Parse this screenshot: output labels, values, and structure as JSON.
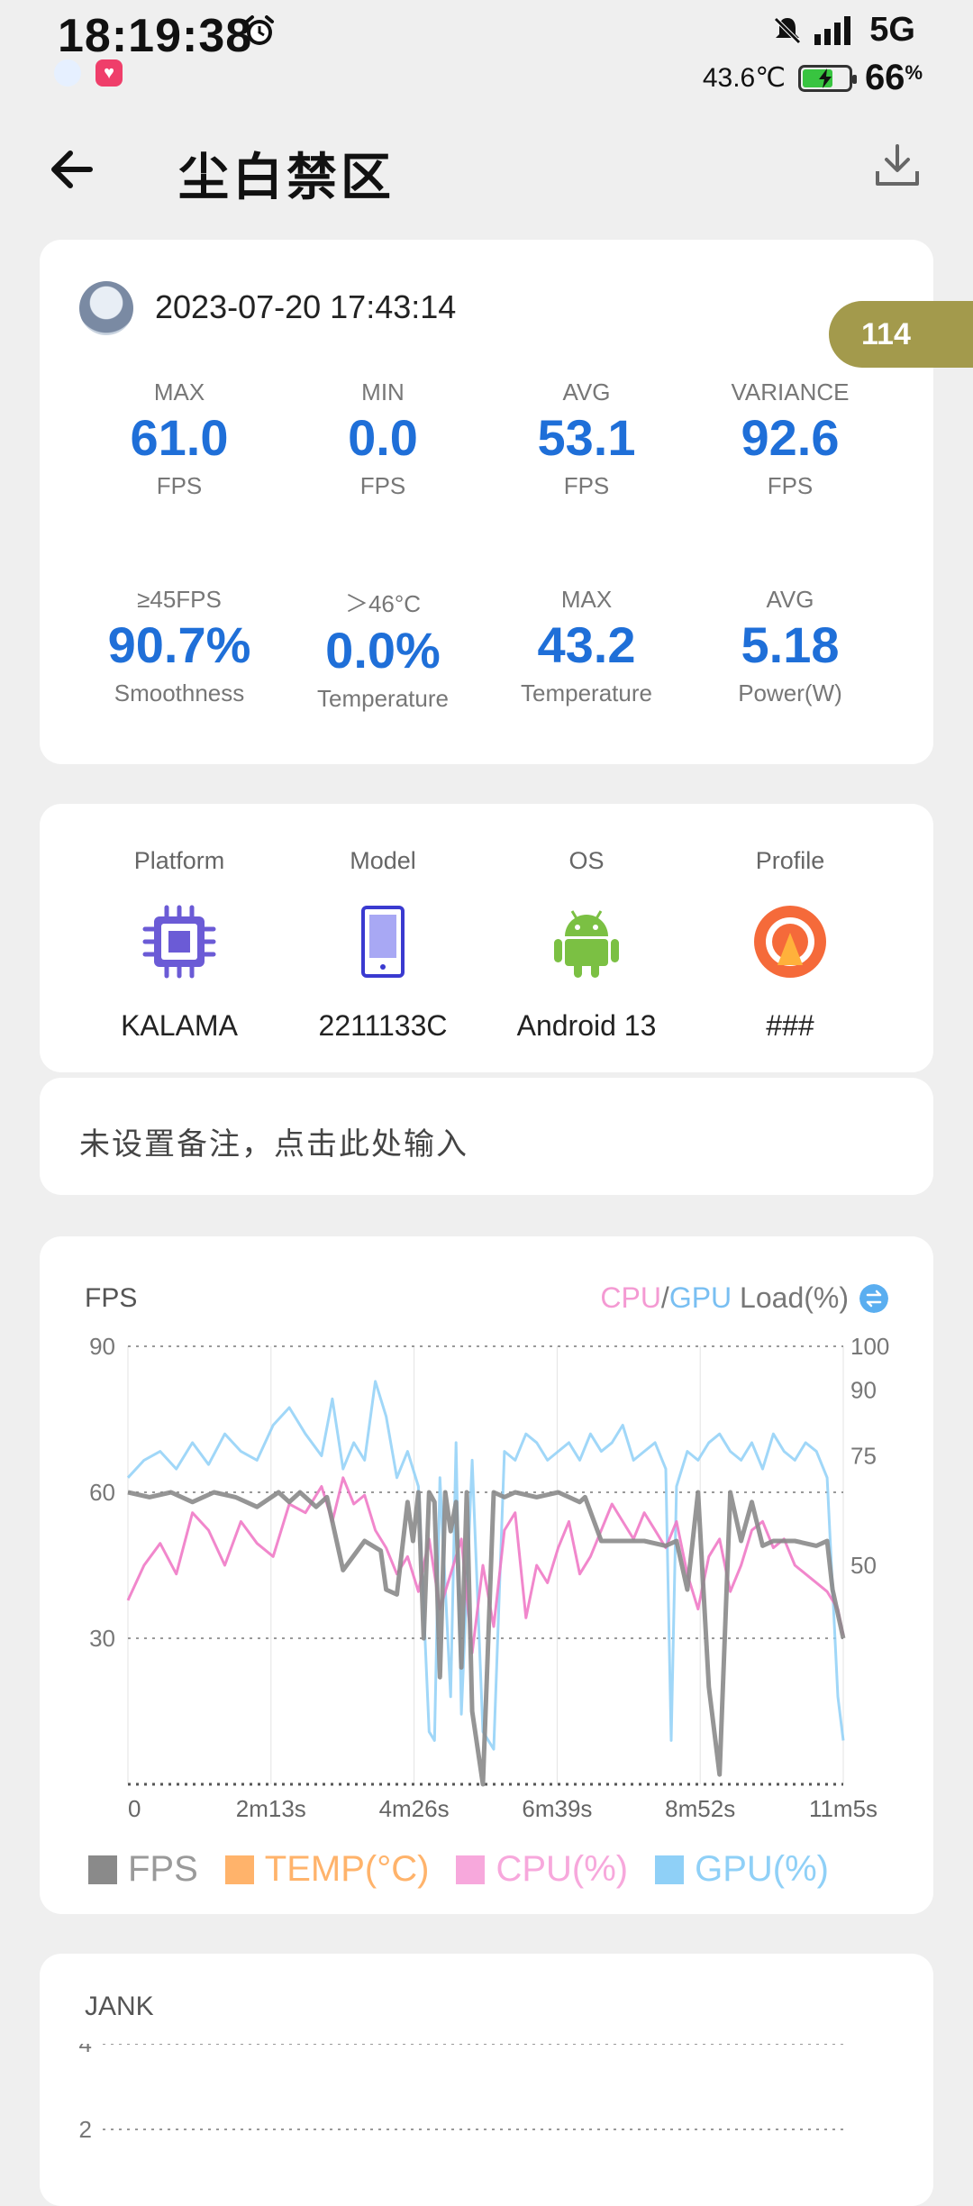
{
  "status_bar": {
    "time": "18:19:38",
    "network": "5G",
    "temperature": "43.6℃",
    "battery": "66",
    "battery_pct_sign": "%",
    "battery_level": 0.66,
    "icons": [
      "alarm-icon",
      "mute-icon",
      "signal-icon",
      "battery-charging-icon",
      "app-notification-icon",
      "heart-notification-icon"
    ]
  },
  "header": {
    "title": "尘白禁区",
    "back_icon": "back-arrow-icon",
    "download_icon": "download-icon"
  },
  "summary": {
    "datetime": "2023-07-20 17:43:14",
    "badge": "114",
    "stats_row1": [
      {
        "label": "MAX",
        "value": "61.0",
        "unit": "FPS"
      },
      {
        "label": "MIN",
        "value": "0.0",
        "unit": "FPS"
      },
      {
        "label": "AVG",
        "value": "53.1",
        "unit": "FPS"
      },
      {
        "label": "VARIANCE",
        "value": "92.6",
        "unit": "FPS"
      }
    ],
    "stats_row2": [
      {
        "label": "≥45FPS",
        "value": "90.7%",
        "unit": "Smoothness"
      },
      {
        "label": "＞46°C",
        "value": "0.0%",
        "unit": "Temperature"
      },
      {
        "label": "MAX",
        "value": "43.2",
        "unit": "Temperature"
      },
      {
        "label": "AVG",
        "value": "5.18",
        "unit": "Power(W)"
      }
    ]
  },
  "device": {
    "items": [
      {
        "label": "Platform",
        "value": "KALAMA",
        "icon": "chip-icon"
      },
      {
        "label": "Model",
        "value": "2211133C",
        "icon": "phone-icon"
      },
      {
        "label": "OS",
        "value": "Android 13",
        "icon": "android-icon"
      },
      {
        "label": "Profile",
        "value": "###",
        "icon": "profile-icon"
      }
    ]
  },
  "note": {
    "text": "未设置备注，点击此处输入"
  },
  "fps_chart": {
    "title": "FPS",
    "toggle_cpu": "CPU",
    "toggle_sep": "/",
    "toggle_gpu": "GPU",
    "toggle_suffix": " Load(%)",
    "colors": {
      "fps": "#8a8a8a",
      "temp": "#ffb36b",
      "cpu": "#f07ac6",
      "gpu": "#8fd0f7"
    },
    "legend": [
      "FPS",
      "TEMP(°C)",
      "CPU(%)",
      "GPU(%)"
    ]
  },
  "jank_chart": {
    "title": "JANK"
  },
  "chart_data": [
    {
      "type": "line",
      "title": "FPS",
      "xlabel": "",
      "ylabel": "",
      "x_ticks": [
        "0",
        "2m13s",
        "4m26s",
        "6m39s",
        "8m52s",
        "11m5s"
      ],
      "x_tick_seconds": [
        0,
        133,
        266,
        399,
        532,
        665
      ],
      "xlim": [
        0,
        665
      ],
      "ylim": [
        0,
        90
      ],
      "y_ticks": [
        "90",
        "60",
        "30"
      ],
      "y2lim": [
        0,
        100
      ],
      "y2_ticks": [
        "100",
        "90",
        "75",
        "50"
      ],
      "grid": true,
      "legend_position": "bottom",
      "series": [
        {
          "name": "FPS",
          "axis": "left",
          "x": [
            0,
            20,
            40,
            60,
            80,
            100,
            120,
            140,
            150,
            160,
            175,
            185,
            200,
            220,
            235,
            240,
            250,
            260,
            265,
            270,
            275,
            280,
            285,
            290,
            295,
            300,
            305,
            310,
            315,
            320,
            330,
            340,
            350,
            360,
            380,
            400,
            420,
            425,
            440,
            460,
            480,
            500,
            510,
            512,
            520,
            530,
            540,
            550,
            560,
            570,
            580,
            590,
            600,
            620,
            640,
            650,
            655,
            665
          ],
          "values": [
            60,
            59,
            60,
            58,
            60,
            59,
            57,
            60,
            58,
            60,
            57,
            59,
            44,
            50,
            48,
            40,
            39,
            58,
            50,
            60,
            30,
            60,
            58,
            22,
            60,
            52,
            58,
            24,
            60,
            15,
            0,
            60,
            59,
            60,
            59,
            60,
            58,
            59,
            50,
            50,
            50,
            49,
            50,
            48,
            40,
            60,
            20,
            2,
            60,
            50,
            58,
            49,
            50,
            50,
            49,
            50,
            40,
            30
          ]
        },
        {
          "name": "CPU(%)",
          "axis": "right",
          "x": [
            0,
            15,
            30,
            45,
            60,
            75,
            90,
            105,
            120,
            135,
            150,
            165,
            180,
            190,
            200,
            210,
            220,
            230,
            240,
            250,
            260,
            270,
            280,
            290,
            300,
            310,
            320,
            330,
            340,
            350,
            360,
            370,
            380,
            390,
            400,
            410,
            420,
            430,
            440,
            450,
            460,
            470,
            480,
            490,
            500,
            510,
            520,
            530,
            540,
            550,
            560,
            570,
            580,
            590,
            600,
            610,
            620,
            630,
            640,
            650,
            660,
            665
          ],
          "values": [
            42,
            50,
            55,
            48,
            62,
            58,
            50,
            60,
            55,
            52,
            64,
            62,
            68,
            60,
            70,
            64,
            66,
            58,
            54,
            48,
            52,
            44,
            56,
            40,
            48,
            56,
            30,
            50,
            36,
            58,
            62,
            38,
            50,
            46,
            54,
            60,
            48,
            52,
            58,
            64,
            60,
            56,
            62,
            58,
            54,
            60,
            48,
            40,
            52,
            56,
            44,
            50,
            58,
            60,
            54,
            56,
            50,
            48,
            46,
            44,
            40,
            34
          ]
        },
        {
          "name": "GPU(%)",
          "axis": "right",
          "x": [
            0,
            15,
            30,
            45,
            60,
            75,
            90,
            105,
            120,
            135,
            150,
            165,
            180,
            190,
            200,
            210,
            220,
            230,
            240,
            250,
            260,
            270,
            280,
            285,
            290,
            300,
            305,
            310,
            320,
            330,
            340,
            350,
            360,
            370,
            380,
            390,
            400,
            410,
            420,
            430,
            440,
            450,
            460,
            470,
            480,
            490,
            500,
            505,
            510,
            520,
            530,
            540,
            550,
            560,
            570,
            580,
            590,
            600,
            610,
            620,
            630,
            640,
            650,
            660,
            665
          ],
          "values": [
            70,
            74,
            76,
            72,
            78,
            73,
            80,
            76,
            74,
            82,
            86,
            80,
            75,
            88,
            72,
            78,
            74,
            92,
            84,
            70,
            76,
            68,
            12,
            10,
            70,
            20,
            78,
            16,
            74,
            12,
            8,
            76,
            74,
            80,
            78,
            74,
            76,
            78,
            74,
            80,
            76,
            78,
            82,
            74,
            76,
            78,
            72,
            10,
            68,
            76,
            74,
            78,
            80,
            76,
            74,
            78,
            72,
            80,
            76,
            74,
            78,
            76,
            70,
            20,
            10
          ]
        }
      ]
    },
    {
      "type": "bar",
      "title": "JANK",
      "ylim": [
        0,
        4
      ],
      "y_ticks": [
        "4",
        "2"
      ]
    }
  ]
}
